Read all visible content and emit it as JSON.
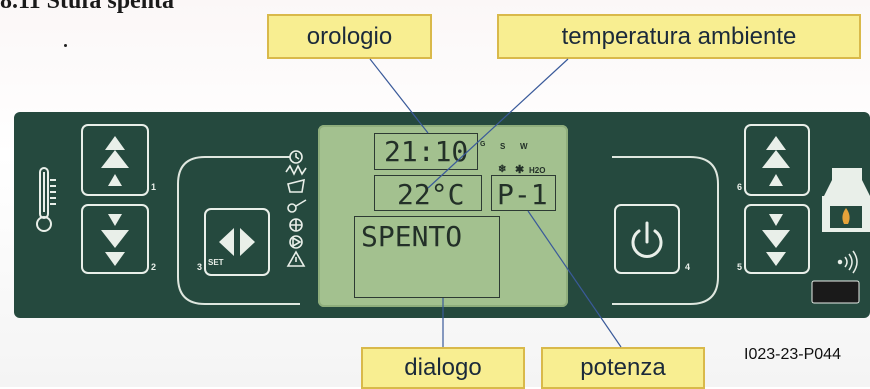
{
  "heading": "8.11 Stufa spenta",
  "callouts": {
    "clock": "orologio",
    "room_temperature": "temperatura ambiente",
    "dialog": "dialogo",
    "power": "potenza"
  },
  "display": {
    "time": "21:10",
    "temperature": "22°C",
    "power_level": "P-1",
    "message": "SPENTO",
    "indicator_s": "S",
    "indicator_w": "W",
    "indicator_h2o": "H2O",
    "indicator_g": "G"
  },
  "buttons": {
    "num_1": "1",
    "num_2": "2",
    "num_3": "3",
    "num_4": "4",
    "num_5": "5",
    "num_6": "6",
    "set_label": "SET"
  },
  "figure_code": "I023-23-P044",
  "colors": {
    "panel": "#25493e",
    "lcd": "#a3c18f",
    "callout_fill": "#f8ee91",
    "callout_border": "#d9b94a"
  }
}
